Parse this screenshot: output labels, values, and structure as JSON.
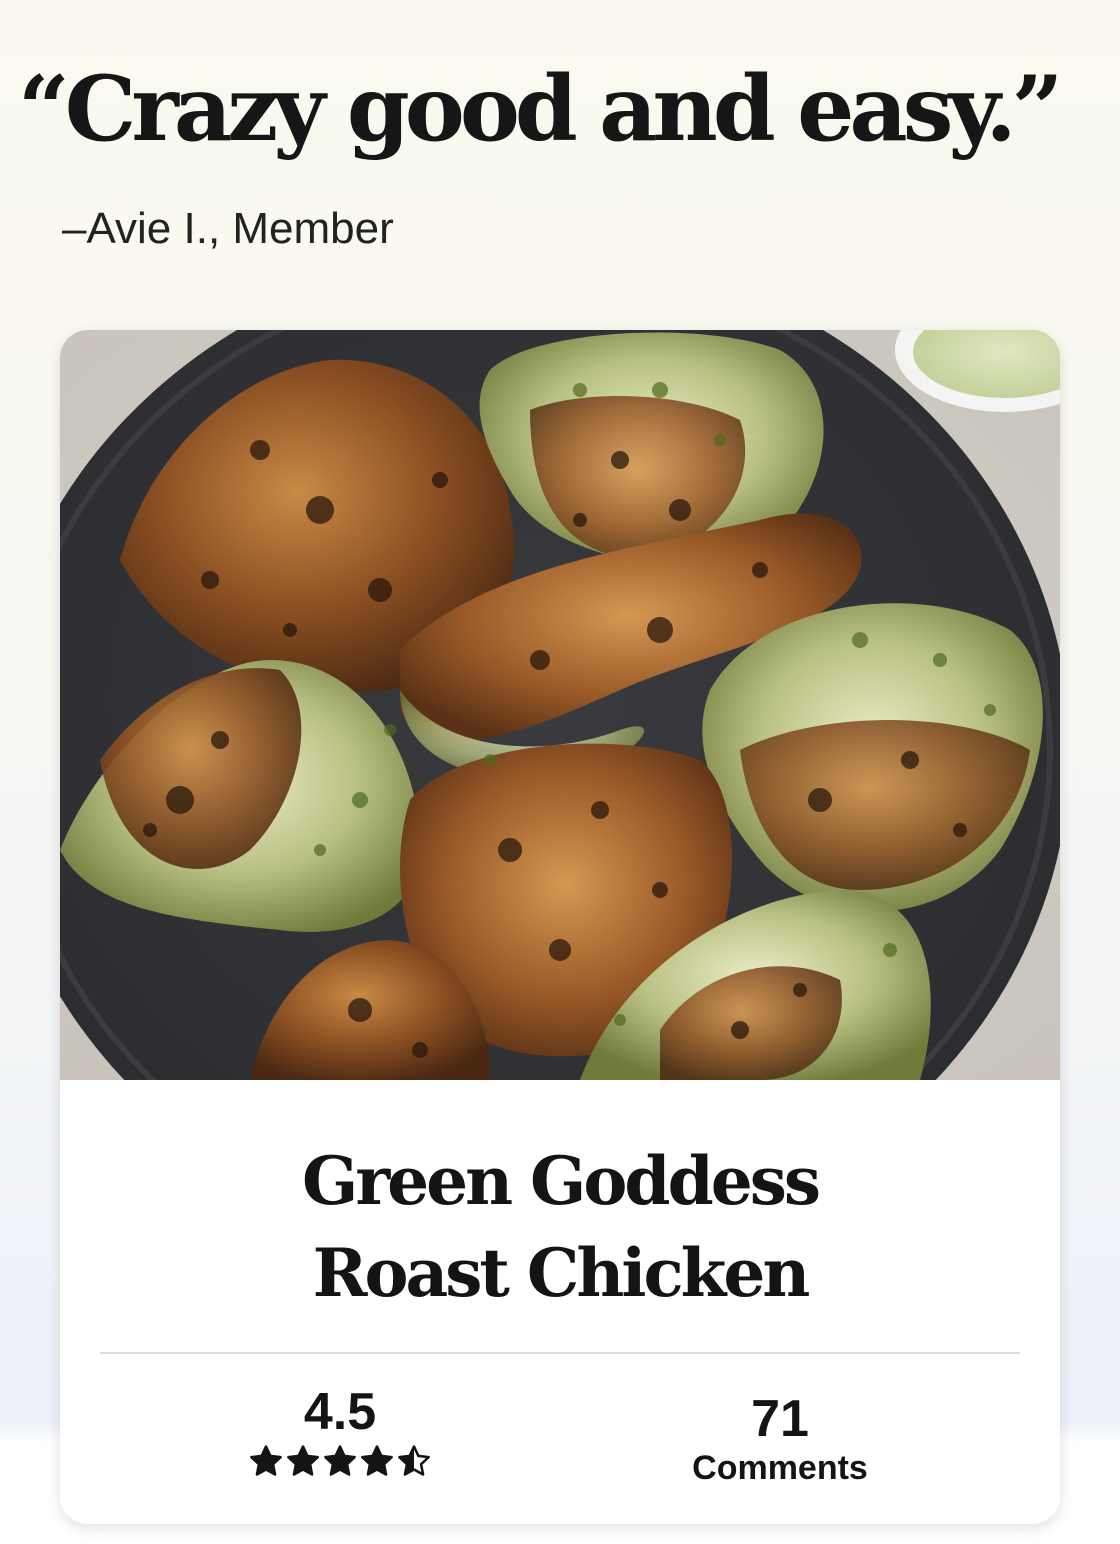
{
  "testimonial": {
    "quote": "“Crazy good and easy.”",
    "attribution": "–Avie I., Member"
  },
  "recipe_card": {
    "image": {
      "subject": "roast-chicken-photo"
    },
    "title_line1": "Green Goddess",
    "title_line2": "Roast Chicken",
    "rating": {
      "value": "4.5",
      "stars": 4.5,
      "max_stars": 5
    },
    "comments": {
      "count": "71",
      "label": "Comments"
    }
  },
  "colors": {
    "background_top": "#fbf9ef",
    "background_bottom": "#ecf0f8",
    "card": "#ffffff",
    "text": "#141414",
    "plate": "#2f3033"
  }
}
